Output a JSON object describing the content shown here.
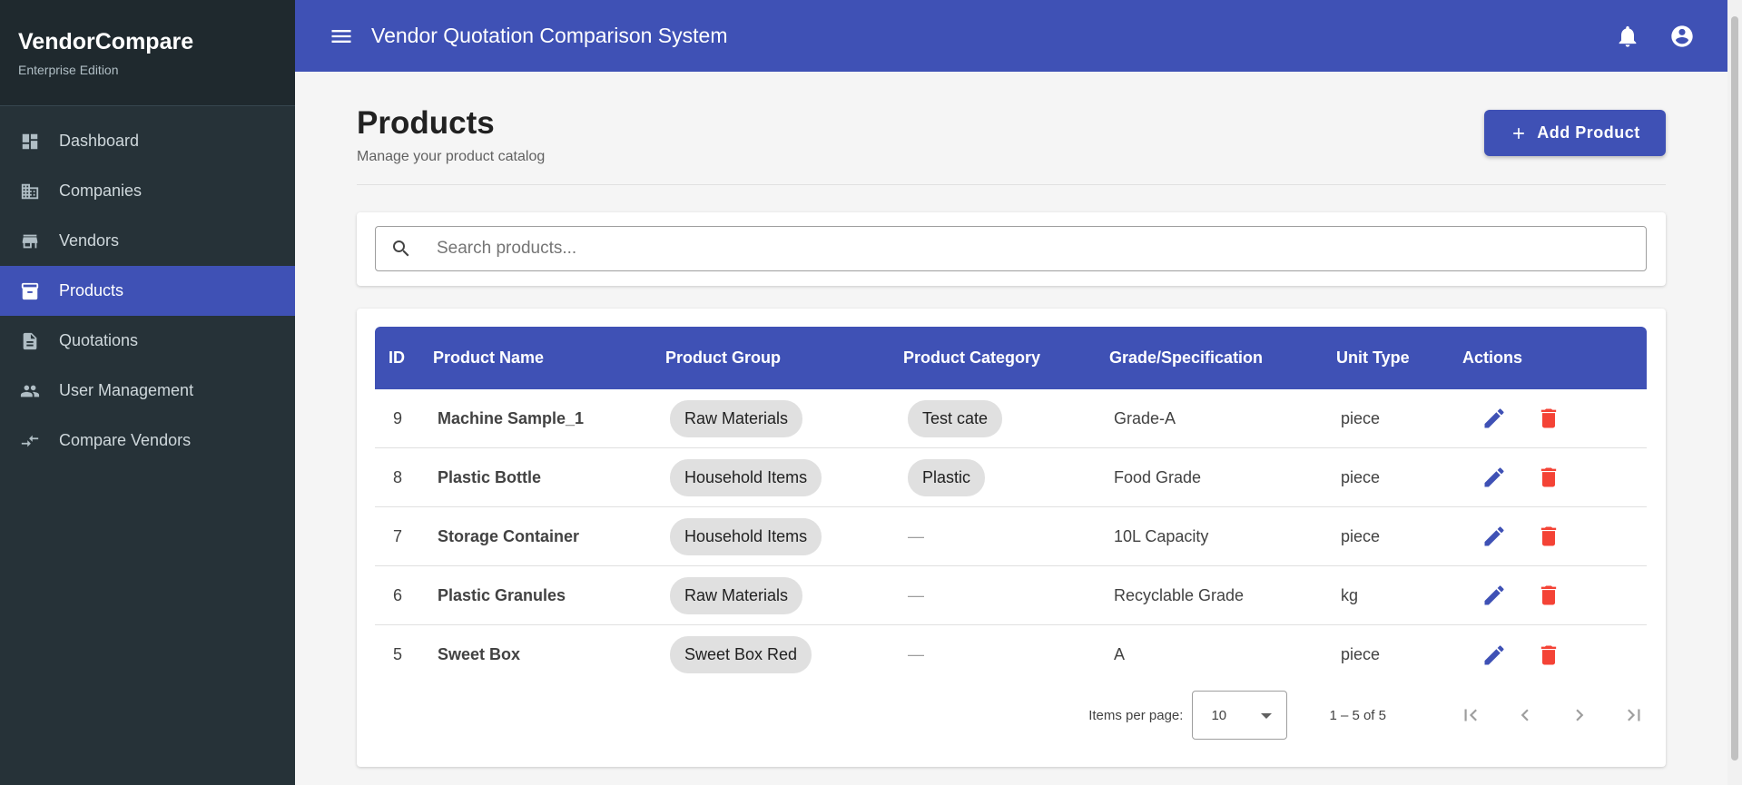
{
  "brand": {
    "title": "VendorCompare",
    "subtitle": "Enterprise Edition"
  },
  "nav": [
    {
      "label": "Dashboard",
      "icon": "dashboard-icon"
    },
    {
      "label": "Companies",
      "icon": "business-icon"
    },
    {
      "label": "Vendors",
      "icon": "store-icon"
    },
    {
      "label": "Products",
      "icon": "inventory-icon",
      "active": true
    },
    {
      "label": "Quotations",
      "icon": "description-icon"
    },
    {
      "label": "User Management",
      "icon": "people-icon"
    },
    {
      "label": "Compare Vendors",
      "icon": "compare-arrows-icon"
    }
  ],
  "topbar": {
    "title": "Vendor Quotation Comparison System",
    "icons": [
      "notifications-icon",
      "account-circle-icon"
    ]
  },
  "page": {
    "title": "Products",
    "subtitle": "Manage your product catalog",
    "add_button": "Add Product"
  },
  "search": {
    "placeholder": "Search products..."
  },
  "table": {
    "headers": {
      "id": "ID",
      "name": "Product Name",
      "group": "Product Group",
      "category": "Product Category",
      "grade": "Grade/Specification",
      "unit": "Unit Type",
      "actions": "Actions"
    },
    "rows": [
      {
        "id": "9",
        "name": "Machine Sample_1",
        "group": "Raw Materials",
        "category": "Test cate",
        "grade": "Grade-A",
        "unit": "piece"
      },
      {
        "id": "8",
        "name": "Plastic Bottle",
        "group": "Household Items",
        "category": "Plastic",
        "grade": "Food Grade",
        "unit": "piece"
      },
      {
        "id": "7",
        "name": "Storage Container",
        "group": "Household Items",
        "category": "—",
        "grade": "10L Capacity",
        "unit": "piece"
      },
      {
        "id": "6",
        "name": "Plastic Granules",
        "group": "Raw Materials",
        "category": "—",
        "grade": "Recyclable Grade",
        "unit": "kg"
      },
      {
        "id": "5",
        "name": "Sweet Box",
        "group": "Sweet Box Red",
        "category": "—",
        "grade": "A",
        "unit": "piece"
      }
    ]
  },
  "paginator": {
    "label": "Items per page:",
    "page_size": "10",
    "range": "1 – 5 of 5"
  },
  "colors": {
    "primary": "#3f51b5",
    "sidebar": "#263238",
    "delete": "#f44336"
  }
}
